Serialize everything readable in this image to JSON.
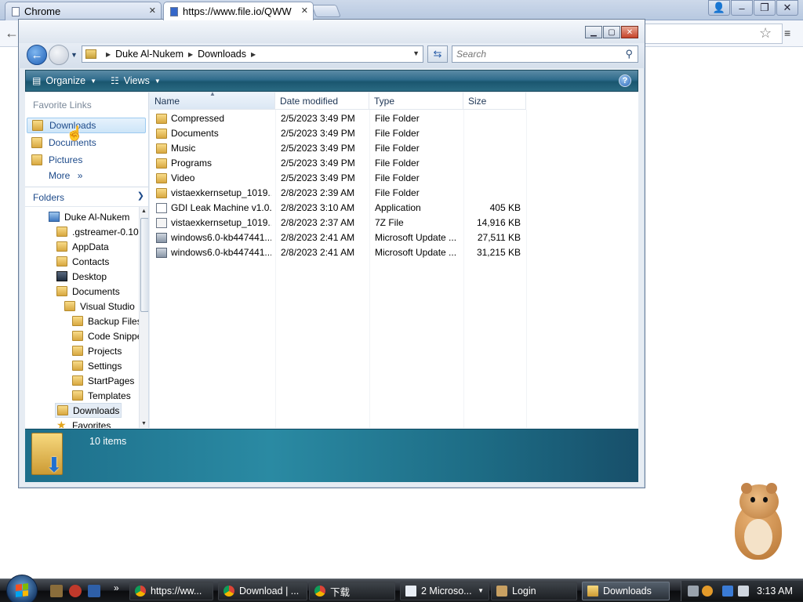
{
  "browser": {
    "tabs": [
      {
        "label": "Chrome",
        "active": false
      },
      {
        "label": "https://www.file.io/QWW",
        "active": true
      }
    ]
  },
  "explorer": {
    "breadcrumb": [
      "Duke Al-Nukem",
      "Downloads"
    ],
    "search_placeholder": "Search",
    "commands": {
      "organize": "Organize",
      "views": "Views"
    },
    "favorite_links_header": "Favorite Links",
    "favorite_links": [
      {
        "label": "Downloads",
        "icon": "downloads-folder-icon",
        "selected": true
      },
      {
        "label": "Documents",
        "icon": "documents-folder-icon",
        "selected": false
      },
      {
        "label": "Pictures",
        "icon": "pictures-folder-icon",
        "selected": false
      }
    ],
    "more_label": "More",
    "more_glyph": "»",
    "folders_header": "Folders",
    "tree": [
      {
        "label": "Duke Al-Nukem",
        "icon": "user-folder-icon",
        "depth": 0
      },
      {
        "label": ".gstreamer-0.10",
        "icon": "folder-icon",
        "depth": 1
      },
      {
        "label": "AppData",
        "icon": "folder-icon",
        "depth": 1
      },
      {
        "label": "Contacts",
        "icon": "contacts-folder-icon",
        "depth": 1
      },
      {
        "label": "Desktop",
        "icon": "desktop-icon",
        "depth": 1
      },
      {
        "label": "Documents",
        "icon": "documents-folder-icon",
        "depth": 1
      },
      {
        "label": "Visual Studio",
        "icon": "folder-icon",
        "depth": 2
      },
      {
        "label": "Backup Files",
        "icon": "folder-icon",
        "depth": 3
      },
      {
        "label": "Code Snippets",
        "icon": "folder-icon",
        "depth": 3
      },
      {
        "label": "Projects",
        "icon": "folder-icon",
        "depth": 3
      },
      {
        "label": "Settings",
        "icon": "folder-icon",
        "depth": 3
      },
      {
        "label": "StartPages",
        "icon": "folder-icon",
        "depth": 3
      },
      {
        "label": "Templates",
        "icon": "folder-icon",
        "depth": 3
      },
      {
        "label": "Downloads",
        "icon": "downloads-folder-icon",
        "depth": 1,
        "selected": true
      },
      {
        "label": "Favorites",
        "icon": "favorites-star-icon",
        "depth": 1
      }
    ],
    "columns": {
      "name": "Name",
      "date": "Date modified",
      "type": "Type",
      "size": "Size"
    },
    "files": [
      {
        "name": "Compressed",
        "date": "2/5/2023 3:49 PM",
        "type": "File Folder",
        "size": "",
        "icon": "folder-icon"
      },
      {
        "name": "Documents",
        "date": "2/5/2023 3:49 PM",
        "type": "File Folder",
        "size": "",
        "icon": "folder-icon"
      },
      {
        "name": "Music",
        "date": "2/5/2023 3:49 PM",
        "type": "File Folder",
        "size": "",
        "icon": "folder-icon"
      },
      {
        "name": "Programs",
        "date": "2/5/2023 3:49 PM",
        "type": "File Folder",
        "size": "",
        "icon": "folder-icon"
      },
      {
        "name": "Video",
        "date": "2/5/2023 3:49 PM",
        "type": "File Folder",
        "size": "",
        "icon": "folder-icon"
      },
      {
        "name": "vistaexkernsetup_1019...",
        "date": "2/8/2023 2:39 AM",
        "type": "File Folder",
        "size": "",
        "icon": "folder-icon"
      },
      {
        "name": "GDI Leak Machine v1.0...",
        "date": "2/8/2023 3:10 AM",
        "type": "Application",
        "size": "405 KB",
        "icon": "application-icon"
      },
      {
        "name": "vistaexkernsetup_1019...",
        "date": "2/8/2023 2:37 AM",
        "type": "7Z File",
        "size": "14,916 KB",
        "icon": "archive-7z-icon"
      },
      {
        "name": "windows6.0-kb447441...",
        "date": "2/8/2023 2:41 AM",
        "type": "Microsoft Update ...",
        "size": "27,511 KB",
        "icon": "update-package-icon"
      },
      {
        "name": "windows6.0-kb447441...",
        "date": "2/8/2023 2:41 AM",
        "type": "Microsoft Update ...",
        "size": "31,215 KB",
        "icon": "update-package-icon"
      }
    ],
    "item_count": "10 items"
  },
  "taskbar": {
    "buttons": [
      {
        "label": "https://ww...",
        "icon": "chrome-icon",
        "active": false
      },
      {
        "label": "Download | ...",
        "icon": "chrome-icon",
        "active": false
      },
      {
        "label": "下载",
        "icon": "chrome-icon",
        "active": false
      },
      {
        "label": "2 Microso...",
        "icon": "window-group-icon",
        "active": false
      },
      {
        "label": "Login",
        "icon": "app-icon",
        "active": false
      },
      {
        "label": "Downloads",
        "icon": "explorer-folder-icon",
        "active": true
      }
    ],
    "clock": "3:13 AM"
  },
  "colors": {
    "command_bar": "#2f6c8c",
    "details_pane": "#2a8aa3",
    "link_blue": "#1d4a8a",
    "taskbar": "#1e2126"
  }
}
